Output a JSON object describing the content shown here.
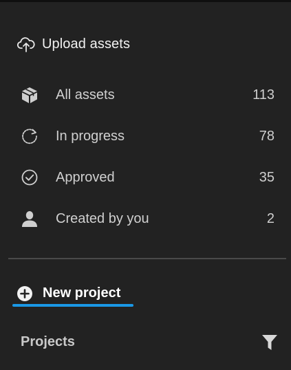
{
  "upload": {
    "label": "Upload assets",
    "icon": "cloud-upload-icon"
  },
  "nav": {
    "items": [
      {
        "label": "All assets",
        "count": "113",
        "icon": "box-icon"
      },
      {
        "label": "In progress",
        "count": "78",
        "icon": "refresh-icon"
      },
      {
        "label": "Approved",
        "count": "35",
        "icon": "check-circle-icon"
      },
      {
        "label": "Created by you",
        "count": "2",
        "icon": "user-icon"
      }
    ]
  },
  "new_project": {
    "label": "New project",
    "icon": "plus-circle-icon"
  },
  "projects": {
    "header": "Projects",
    "filter_icon": "filter-icon"
  },
  "colors": {
    "background": "#222222",
    "accent": "#1a98e6",
    "text": "#d0d0d0"
  }
}
